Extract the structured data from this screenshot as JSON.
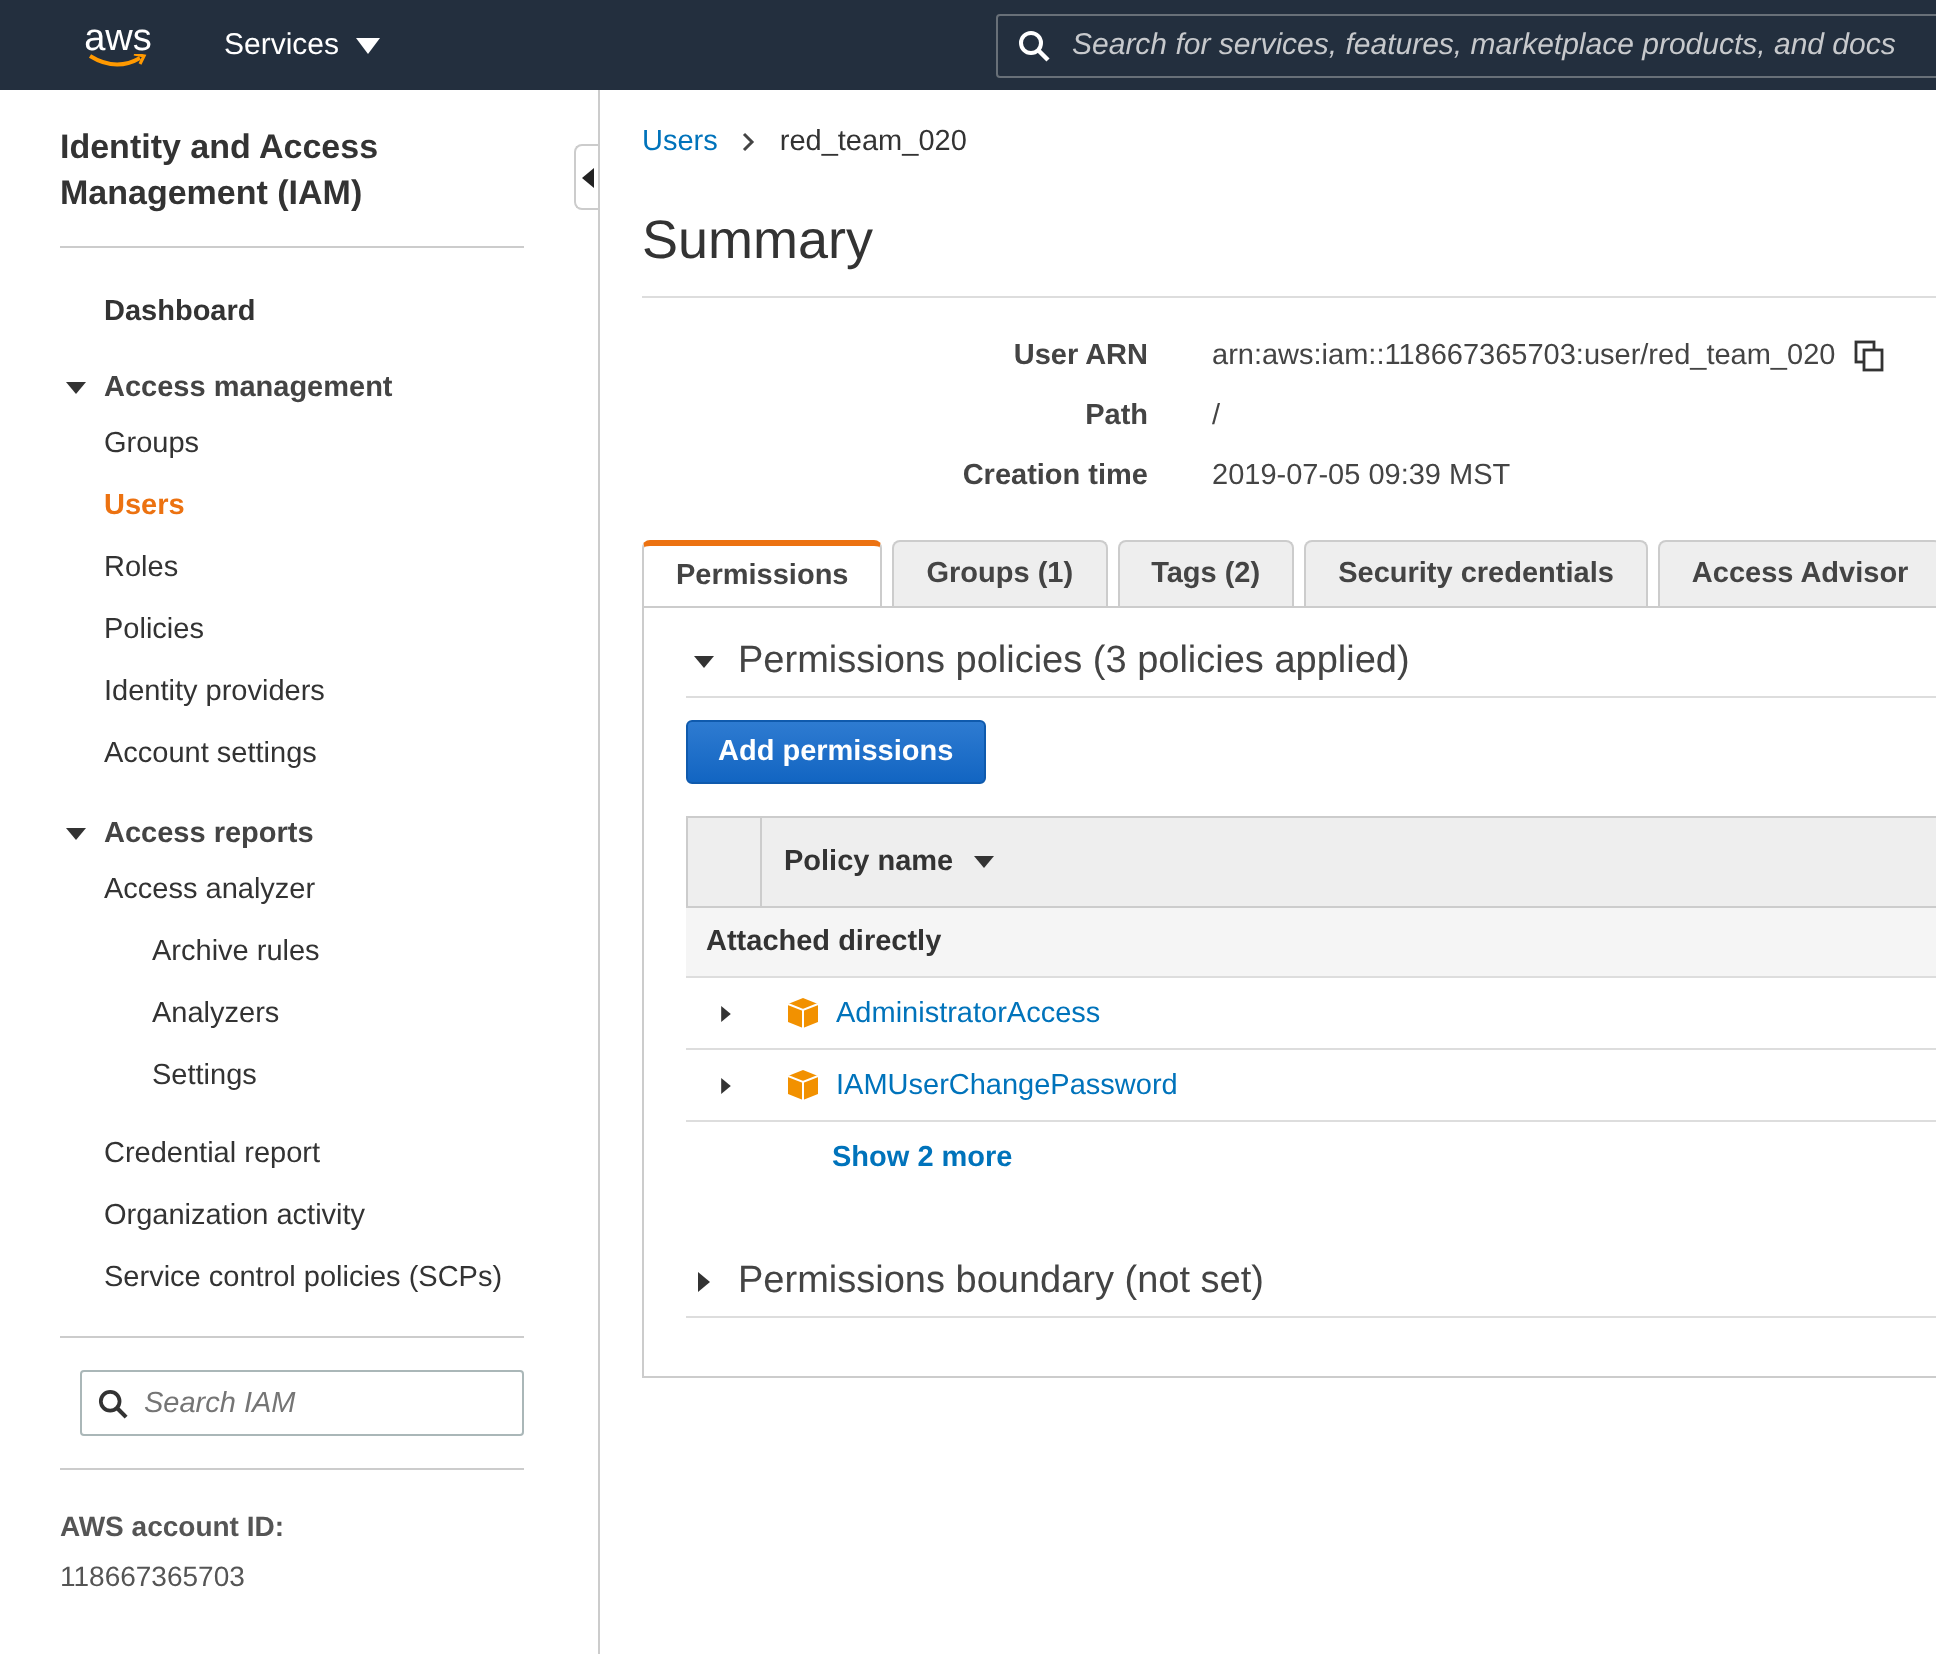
{
  "topbar": {
    "logo": "aws",
    "services_menu": "Services",
    "search": {
      "placeholder": "Search for services, features, marketplace products, and docs"
    }
  },
  "sidebar": {
    "title": "Identity and Access Management (IAM)",
    "items": [
      {
        "label": "Dashboard",
        "kind": "top",
        "selected": false
      },
      {
        "label": "Access management",
        "kind": "section",
        "expanded": true,
        "children": [
          {
            "label": "Groups",
            "kind": "link",
            "selected": false
          },
          {
            "label": "Users",
            "kind": "link",
            "selected": true
          },
          {
            "label": "Roles",
            "kind": "link",
            "selected": false
          },
          {
            "label": "Policies",
            "kind": "link",
            "selected": false
          },
          {
            "label": "Identity providers",
            "kind": "link",
            "selected": false
          },
          {
            "label": "Account settings",
            "kind": "link",
            "selected": false
          }
        ]
      },
      {
        "label": "Access reports",
        "kind": "section",
        "expanded": true,
        "children": [
          {
            "label": "Access analyzer",
            "kind": "link",
            "selected": false,
            "children": [
              {
                "label": "Archive rules",
                "kind": "link",
                "selected": false
              },
              {
                "label": "Analyzers",
                "kind": "link",
                "selected": false
              },
              {
                "label": "Settings",
                "kind": "link",
                "selected": false
              }
            ]
          },
          {
            "label": "Credential report",
            "kind": "link",
            "selected": false
          },
          {
            "label": "Organization activity",
            "kind": "link",
            "selected": false
          },
          {
            "label": "Service control policies (SCPs)",
            "kind": "link",
            "selected": false
          }
        ]
      }
    ],
    "search": {
      "placeholder": "Search IAM"
    },
    "account_id_label": "AWS account ID:",
    "account_id": "118667365703"
  },
  "breadcrumb": [
    {
      "label": "Users",
      "kind": "link"
    },
    {
      "label": "red_team_020",
      "kind": "current"
    }
  ],
  "title": "Summary",
  "details": [
    {
      "label": "User ARN",
      "value": "arn:aws:iam::118667365703:user/red_team_020",
      "copyable": true
    },
    {
      "label": "Path",
      "value": "/",
      "copyable": false
    },
    {
      "label": "Creation time",
      "value": "2019-07-05 09:39 MST",
      "copyable": false
    }
  ],
  "tabs": [
    {
      "label": "Permissions",
      "selected": true
    },
    {
      "label": "Groups (1)",
      "selected": false
    },
    {
      "label": "Tags (2)",
      "selected": false
    },
    {
      "label": "Security credentials",
      "selected": false
    },
    {
      "label": "Access Advisor",
      "selected": false
    }
  ],
  "policies_section": {
    "title": "Permissions policies (3 policies applied)",
    "expanded": true,
    "button": "Add permissions",
    "columns": [
      "Policy name"
    ],
    "group": "Attached directly",
    "rows": [
      {
        "name": "AdministratorAccess",
        "expanded": false
      },
      {
        "name": "IAMUserChangePassword",
        "expanded": false
      }
    ],
    "show_more": "Show 2 more"
  },
  "boundary_section": {
    "title": "Permissions boundary (not set)",
    "expanded": false
  }
}
